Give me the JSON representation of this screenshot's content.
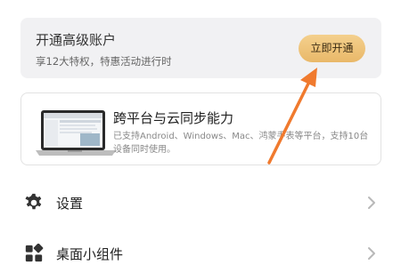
{
  "premium": {
    "title": "开通高级账户",
    "subtitle": "享12大特权，特惠活动进行时",
    "button_label": "立即开通"
  },
  "feature": {
    "title": "跨平台与云同步能力",
    "description": "已支持Android、Windows、Mac、鸿蒙手表等平台，支持10台设备同时使用。"
  },
  "menu": {
    "items": [
      {
        "label": "设置",
        "icon": "gear-icon"
      },
      {
        "label": "桌面小组件",
        "icon": "widgets-icon"
      }
    ]
  },
  "colors": {
    "accent_button": "#e9b869",
    "annotation_arrow": "#f07a2e"
  }
}
